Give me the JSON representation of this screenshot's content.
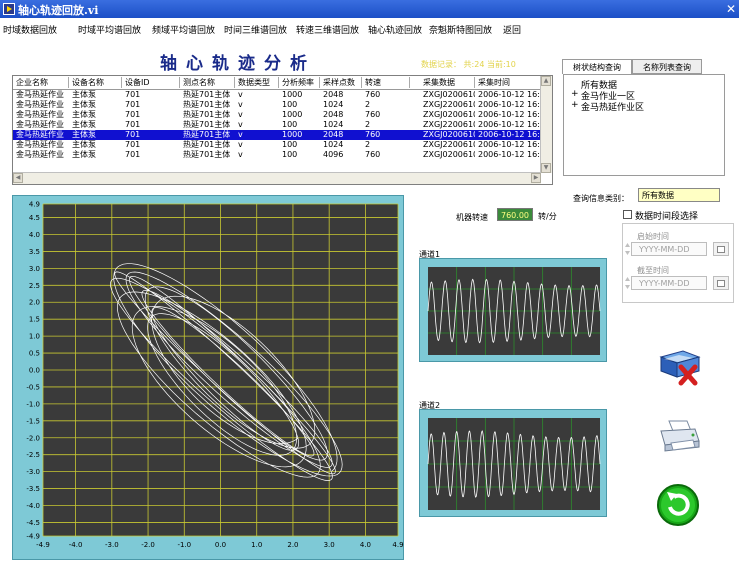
{
  "window": {
    "title": "轴心轨迹回放.vi",
    "close_label": "✕"
  },
  "menu": [
    "时域数据回放",
    "时域平均谱回放",
    "频域平均谱回放",
    "时间三维谱回放",
    "转速三维谱回放",
    "轴心轨迹回放",
    "奈魁斯特图回放",
    "返回"
  ],
  "heading": "轴心轨迹分析",
  "record_info": {
    "text": "数据记录：  共:24  当前:10"
  },
  "table": {
    "columns": [
      "企业名称",
      "设备名称",
      "设备ID",
      "测点名称",
      "数据类型",
      "分析频率",
      "采样点数",
      "转速",
      "采集数据",
      "采集时间"
    ],
    "rows": [
      [
        "金马热延作业",
        "主体泵",
        "701",
        "热延701主体",
        "v",
        "1000",
        "2048",
        "760",
        "ZXGJ0200610I",
        "2006-10-12 16:05"
      ],
      [
        "金马热延作业",
        "主体泵",
        "701",
        "热延701主体",
        "v",
        "100",
        "1024",
        "2",
        "ZXGJ2200610I",
        "2006-10-12 16:05"
      ],
      [
        "金马热延作业",
        "主体泵",
        "701",
        "热延701主体",
        "v",
        "1000",
        "2048",
        "760",
        "ZXGJ0200610I",
        "2006-10-12 16:06"
      ],
      [
        "金马热延作业",
        "主体泵",
        "701",
        "热延701主体",
        "v",
        "100",
        "1024",
        "2",
        "ZXGJ2200610I",
        "2006-10-12 16:06"
      ],
      [
        "金马热延作业",
        "主体泵",
        "701",
        "热延701主体",
        "v",
        "1000",
        "2048",
        "760",
        "ZXGJ0200610I",
        "2006-10-12 16:06"
      ],
      [
        "金马热延作业",
        "主体泵",
        "701",
        "热延701主体",
        "v",
        "100",
        "1024",
        "2",
        "ZXGJ2200610I",
        "2006-10-12 16:06"
      ],
      [
        "金马热延作业",
        "主体泵",
        "701",
        "热延701主体",
        "v",
        "100",
        "4096",
        "760",
        "ZXGJ0200610I",
        "2006-10-12 16:06"
      ]
    ],
    "selected_row": 4
  },
  "tabs": [
    "树状结构查询",
    "名称列表查询"
  ],
  "tree": {
    "root": "所有数据",
    "children": [
      "金马作业一区",
      "金马热延作业区"
    ]
  },
  "query": {
    "label": "查询信息类别：",
    "value": "所有数据"
  },
  "speed": {
    "label": "机器转速",
    "value": "760.00",
    "unit": "转/分"
  },
  "date_range": {
    "checkbox_label": "数据时间段选择",
    "checked": false,
    "start_label": "启始时间",
    "start_placeholder": "YYYY-MM-DD",
    "end_label": "截至时间",
    "end_placeholder": "YYYY-MM-DD"
  },
  "channels": [
    {
      "label": "通道1",
      "cycles": 12.5
    },
    {
      "label": "通道2",
      "cycles": 13.5
    }
  ],
  "icons": [
    "delete-book-icon",
    "print-icon",
    "refresh-icon"
  ],
  "colors": {
    "plot_bg": "#3a3a3a",
    "grid": "#c8c832",
    "trace": "#ffffff",
    "frame": "#7ec9d6",
    "selected_row": "#1010d0"
  },
  "chart_data": {
    "type": "line",
    "title": "",
    "xlabel": "",
    "ylabel": "",
    "xlim": [
      -4.9,
      4.9
    ],
    "ylim": [
      -4.9,
      4.9
    ],
    "xticks": [
      "-4.9",
      "-4.0",
      "-3.0",
      "-2.0",
      "-1.0",
      "0.0",
      "1.0",
      "2.0",
      "3.0",
      "4.0",
      "4.9"
    ],
    "yticks": [
      "4.9",
      "4.5",
      "4.0",
      "3.5",
      "3.0",
      "2.5",
      "2.0",
      "1.5",
      "1.0",
      "0.5",
      "0.0",
      "-0.5",
      "-1.0",
      "-1.5",
      "-2.0",
      "-2.5",
      "-3.0",
      "-3.5",
      "-4.0",
      "-4.5",
      "-4.9"
    ],
    "grid": true,
    "orbit": {
      "center": [
        0.1,
        -0.2
      ],
      "axis_angle_deg": -45,
      "semi_major": 4.3,
      "semi_minor": 1.1,
      "loops": 12
    }
  }
}
